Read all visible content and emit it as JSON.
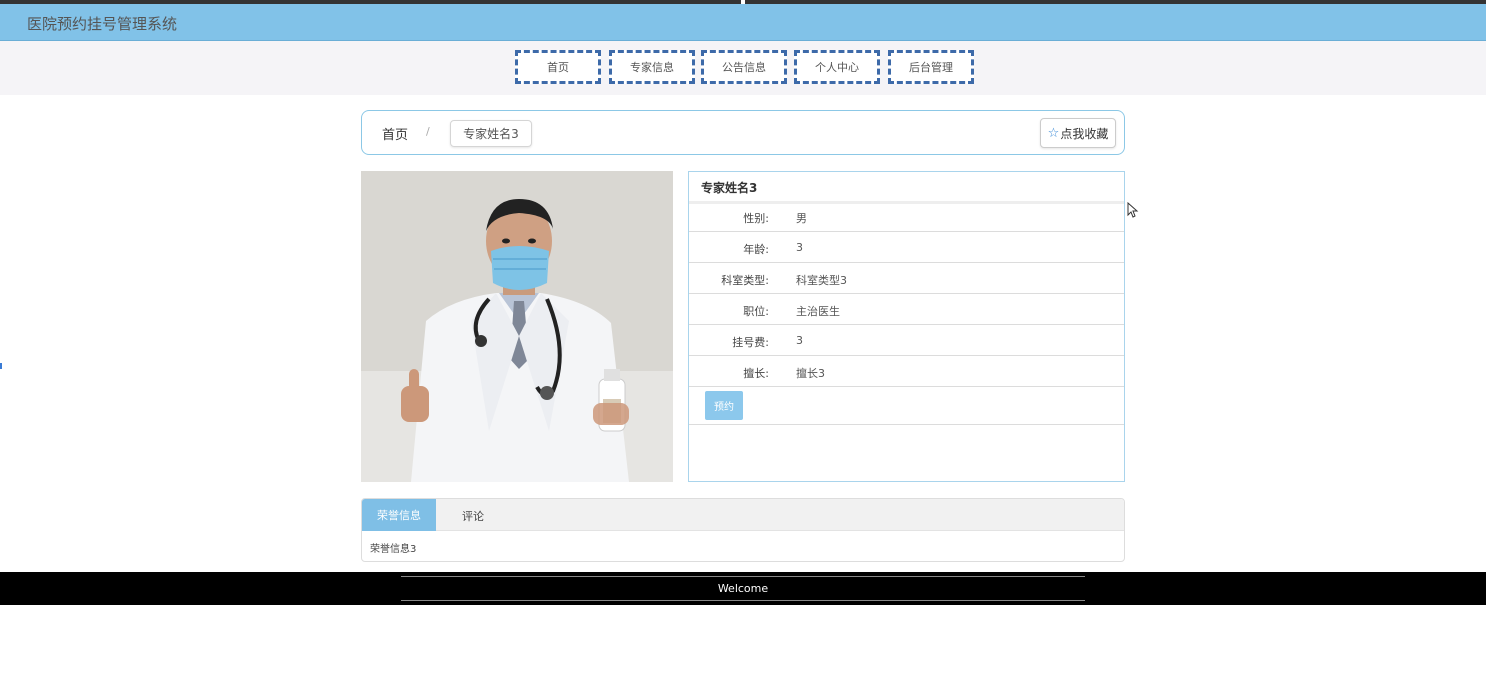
{
  "app": {
    "title": "医院预约挂号管理系统"
  },
  "nav": [
    {
      "label": "首页"
    },
    {
      "label": "专家信息"
    },
    {
      "label": "公告信息"
    },
    {
      "label": "个人中心"
    },
    {
      "label": "后台管理"
    }
  ],
  "breadcrumb": {
    "home": "首页",
    "separator": "/",
    "current": "专家姓名3"
  },
  "favorite": {
    "label": "点我收藏",
    "icon": "star-icon"
  },
  "expert": {
    "name": "专家姓名3",
    "fields": [
      {
        "label": "性别:",
        "value": "男"
      },
      {
        "label": "年龄:",
        "value": "3"
      },
      {
        "label": "科室类型:",
        "value": "科室类型3"
      },
      {
        "label": "职位:",
        "value": "主治医生"
      },
      {
        "label": "挂号费:",
        "value": "3"
      },
      {
        "label": "擅长:",
        "value": "擅长3"
      }
    ],
    "book_label": "预约"
  },
  "tabs": {
    "items": [
      {
        "label": "荣誉信息"
      },
      {
        "label": "评论"
      }
    ],
    "content": "荣誉信息3"
  },
  "footer": {
    "text": "Welcome"
  },
  "colors": {
    "header": "#81c2e8",
    "nav_border": "#3d6aa9",
    "accent": "#7fbfe6",
    "footer": "#000000"
  }
}
